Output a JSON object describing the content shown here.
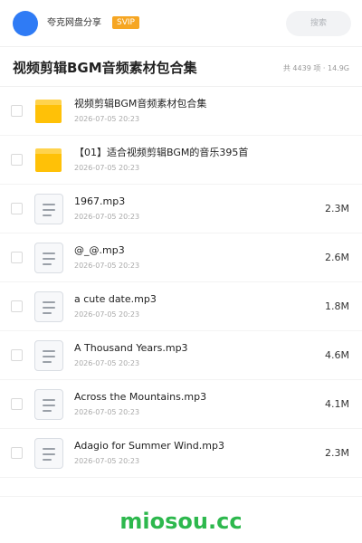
{
  "header": {
    "share_title": "夸克网盘分享",
    "badge": "SVIP",
    "search_placeholder": "搜索",
    "avatar_color": "#2f7bf5",
    "badge_color": "#f6a623"
  },
  "folder": {
    "title": "视频剪辑BGM音频素材包合集",
    "item_count": "共 4439 项",
    "separator": "·",
    "total_size": "14.9G"
  },
  "items": [
    {
      "type": "folder",
      "icon": "folder-icon",
      "name": "视频剪辑BGM音频素材包合集",
      "date": "2026-07-05 20:23",
      "size": ""
    },
    {
      "type": "folder",
      "icon": "folder-icon",
      "name": "【01】适合视频剪辑BGM的音乐395首",
      "date": "2026-07-05 20:23",
      "size": ""
    },
    {
      "type": "file",
      "icon": "document-icon",
      "name": "1967.mp3",
      "date": "2026-07-05 20:23",
      "size": "2.3M"
    },
    {
      "type": "file",
      "icon": "document-icon",
      "name": "@_@.mp3",
      "date": "2026-07-05 20:23",
      "size": "2.6M"
    },
    {
      "type": "file",
      "icon": "document-icon",
      "name": "a cute date.mp3",
      "date": "2026-07-05 20:23",
      "size": "1.8M"
    },
    {
      "type": "file",
      "icon": "document-icon",
      "name": "A Thousand Years.mp3",
      "date": "2026-07-05 20:23",
      "size": "4.6M"
    },
    {
      "type": "file",
      "icon": "document-icon",
      "name": "Across the Mountains.mp3",
      "date": "2026-07-05 20:23",
      "size": "4.1M"
    },
    {
      "type": "file",
      "icon": "document-icon",
      "name": "Adagio for Summer Wind.mp3",
      "date": "2026-07-05 20:23",
      "size": "2.3M"
    }
  ],
  "footer": {
    "watermark": "miosou.cc",
    "watermark_color": "#2db84d"
  }
}
